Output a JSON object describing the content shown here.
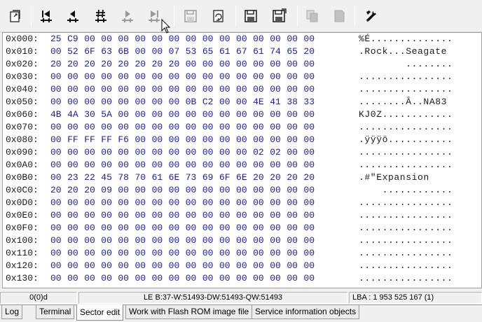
{
  "toolbar": {
    "buttons": [
      {
        "name": "open-icon"
      },
      {
        "name": "first-sector-icon"
      },
      {
        "name": "previous-sector-icon"
      },
      {
        "name": "goto-sector-icon"
      },
      {
        "name": "next-sector-icon"
      },
      {
        "name": "last-sector-icon"
      },
      {
        "name": "save-icon"
      },
      {
        "name": "refresh-icon"
      },
      {
        "name": "read-sector-icon"
      },
      {
        "name": "write-sector-icon"
      },
      {
        "name": "copy-icon"
      },
      {
        "name": "paste-icon"
      },
      {
        "name": "tools-icon"
      }
    ]
  },
  "hex": {
    "rows": [
      {
        "addr": "0x000:",
        "bytes": [
          "25",
          "C9",
          "00",
          "00",
          "00",
          "00",
          "00",
          "00",
          "00",
          "00",
          "00",
          "00",
          "00",
          "00",
          "00",
          "00"
        ],
        "ascii": "%É.............."
      },
      {
        "addr": "0x010:",
        "bytes": [
          "00",
          "52",
          "6F",
          "63",
          "6B",
          "00",
          "00",
          "07",
          "53",
          "65",
          "61",
          "67",
          "61",
          "74",
          "65",
          "20"
        ],
        "ascii": ".Rock...Seagate "
      },
      {
        "addr": "0x020:",
        "bytes": [
          "20",
          "20",
          "20",
          "20",
          "20",
          "20",
          "20",
          "20",
          "00",
          "00",
          "00",
          "00",
          "00",
          "00",
          "00",
          "00"
        ],
        "ascii": "        ........"
      },
      {
        "addr": "0x030:",
        "bytes": [
          "00",
          "00",
          "00",
          "00",
          "00",
          "00",
          "00",
          "00",
          "00",
          "00",
          "00",
          "00",
          "00",
          "00",
          "00",
          "00"
        ],
        "ascii": "................"
      },
      {
        "addr": "0x040:",
        "bytes": [
          "00",
          "00",
          "00",
          "00",
          "00",
          "00",
          "00",
          "00",
          "00",
          "00",
          "00",
          "00",
          "00",
          "00",
          "00",
          "00"
        ],
        "ascii": "................"
      },
      {
        "addr": "0x050:",
        "bytes": [
          "00",
          "00",
          "00",
          "00",
          "00",
          "00",
          "00",
          "00",
          "0B",
          "C2",
          "00",
          "00",
          "4E",
          "41",
          "38",
          "33"
        ],
        "ascii": "........Â..NA83"
      },
      {
        "addr": "0x060:",
        "bytes": [
          "4B",
          "4A",
          "30",
          "5A",
          "00",
          "00",
          "00",
          "00",
          "00",
          "00",
          "00",
          "00",
          "00",
          "00",
          "00",
          "00"
        ],
        "ascii": "KJ0Z............"
      },
      {
        "addr": "0x070:",
        "bytes": [
          "00",
          "00",
          "00",
          "00",
          "00",
          "00",
          "00",
          "00",
          "00",
          "00",
          "00",
          "00",
          "00",
          "00",
          "00",
          "00"
        ],
        "ascii": "................"
      },
      {
        "addr": "0x080:",
        "bytes": [
          "00",
          "FF",
          "FF",
          "FF",
          "F6",
          "00",
          "00",
          "00",
          "00",
          "00",
          "00",
          "00",
          "00",
          "00",
          "00",
          "00"
        ],
        "ascii": ".ÿÿÿö..........."
      },
      {
        "addr": "0x090:",
        "bytes": [
          "00",
          "00",
          "00",
          "00",
          "00",
          "00",
          "00",
          "00",
          "00",
          "00",
          "00",
          "00",
          "02",
          "02",
          "00",
          "00"
        ],
        "ascii": "................"
      },
      {
        "addr": "0x0A0:",
        "bytes": [
          "00",
          "00",
          "00",
          "00",
          "00",
          "00",
          "00",
          "00",
          "00",
          "00",
          "00",
          "00",
          "00",
          "00",
          "00",
          "00"
        ],
        "ascii": "................"
      },
      {
        "addr": "0x0B0:",
        "bytes": [
          "00",
          "23",
          "22",
          "45",
          "78",
          "70",
          "61",
          "6E",
          "73",
          "69",
          "6F",
          "6E",
          "20",
          "20",
          "20",
          "20"
        ],
        "ascii": ".#\"Expansion    "
      },
      {
        "addr": "0x0C0:",
        "bytes": [
          "20",
          "20",
          "20",
          "09",
          "00",
          "00",
          "00",
          "00",
          "00",
          "00",
          "00",
          "00",
          "00",
          "00",
          "00",
          "00"
        ],
        "ascii": "    ............"
      },
      {
        "addr": "0x0D0:",
        "bytes": [
          "00",
          "00",
          "00",
          "00",
          "00",
          "00",
          "00",
          "00",
          "00",
          "00",
          "00",
          "00",
          "00",
          "00",
          "00",
          "00"
        ],
        "ascii": "................"
      },
      {
        "addr": "0x0E0:",
        "bytes": [
          "00",
          "00",
          "00",
          "00",
          "00",
          "00",
          "00",
          "00",
          "00",
          "00",
          "00",
          "00",
          "00",
          "00",
          "00",
          "00"
        ],
        "ascii": "................"
      },
      {
        "addr": "0x0F0:",
        "bytes": [
          "00",
          "00",
          "00",
          "00",
          "00",
          "00",
          "00",
          "00",
          "00",
          "00",
          "00",
          "00",
          "00",
          "00",
          "00",
          "00"
        ],
        "ascii": "................"
      },
      {
        "addr": "0x100:",
        "bytes": [
          "00",
          "00",
          "00",
          "00",
          "00",
          "00",
          "00",
          "00",
          "00",
          "00",
          "00",
          "00",
          "00",
          "00",
          "00",
          "00"
        ],
        "ascii": "................"
      },
      {
        "addr": "0x110:",
        "bytes": [
          "00",
          "00",
          "00",
          "00",
          "00",
          "00",
          "00",
          "00",
          "00",
          "00",
          "00",
          "00",
          "00",
          "00",
          "00",
          "00"
        ],
        "ascii": "................"
      },
      {
        "addr": "0x120:",
        "bytes": [
          "00",
          "00",
          "00",
          "00",
          "00",
          "00",
          "00",
          "00",
          "00",
          "00",
          "00",
          "00",
          "00",
          "00",
          "00",
          "00"
        ],
        "ascii": "................"
      },
      {
        "addr": "0x130:",
        "bytes": [
          "00",
          "00",
          "00",
          "00",
          "00",
          "00",
          "00",
          "00",
          "00",
          "00",
          "00",
          "00",
          "00",
          "00",
          "00",
          "00"
        ],
        "ascii": "................"
      }
    ]
  },
  "status": {
    "offset": "0(0)d",
    "value": "LE B:37-W:51493-DW:51493-QW:51493",
    "lba": "LBA : 1 953 525 167 (1)"
  },
  "tabs": [
    {
      "label": "Log",
      "active": false
    },
    {
      "label": "Terminal",
      "active": false
    },
    {
      "label": "Sector edit",
      "active": true
    },
    {
      "label": "Work with Flash ROM image file",
      "active": false
    },
    {
      "label": "Service information objects",
      "active": false
    }
  ],
  "colors": {
    "hex_text": "#1b1ba0",
    "background": "#ffffff",
    "chrome": "#f0f0f0"
  }
}
